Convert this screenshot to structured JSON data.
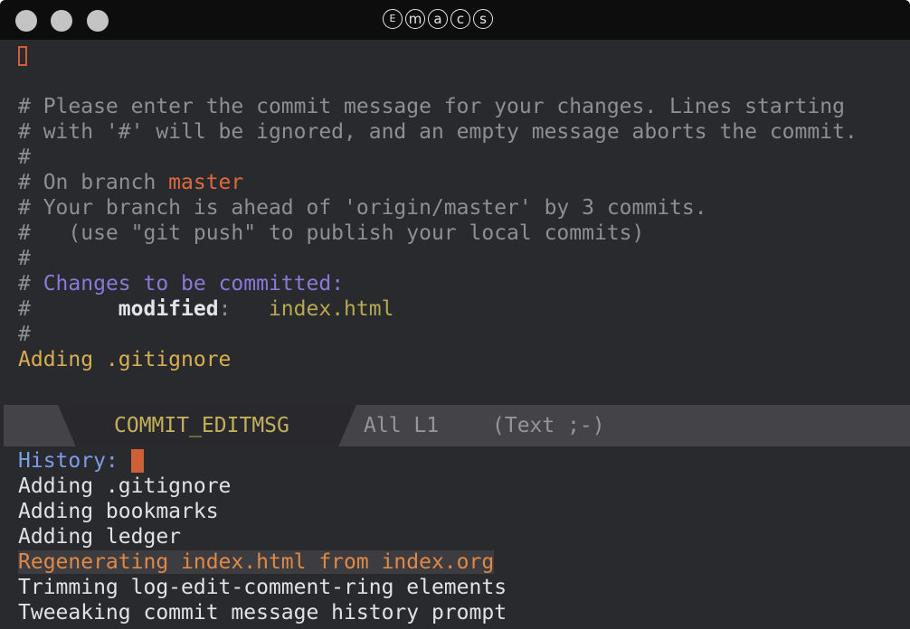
{
  "window": {
    "title_letters": [
      "E",
      "m",
      "a",
      "c",
      "s"
    ]
  },
  "editor": {
    "lines": [
      "# Please enter the commit message for your changes. Lines starting",
      "# with '#' will be ignored, and an empty message aborts the commit.",
      "#"
    ],
    "branch_prefix": "# On branch ",
    "branch": "master",
    "ahead_line": "# Your branch is ahead of 'origin/master' by 3 commits.",
    "push_hint": "#   (use \"git push\" to publish your local commits)",
    "blank_comment": "#",
    "changes_hash": "# ",
    "changes_header": "Changes to be committed:",
    "modified_prefix": "#       ",
    "modified_label": "modified",
    "modified_sep": ":   ",
    "modified_file": "index.html",
    "end_comment": "#",
    "message": "Adding .gitignore"
  },
  "modeline": {
    "buffer_name": "COMMIT_EDITMSG",
    "position": "All L1",
    "mode": "(Text ;-)"
  },
  "minibuffer": {
    "prompt": "History:",
    "history": [
      "Adding .gitignore",
      "Adding bookmarks",
      "Adding ledger",
      "Regenerating index.html from index.org",
      "Trimming log-edit-comment-ring elements",
      "Tweeaking commit message history prompt"
    ],
    "selected_index": 3
  },
  "colors": {
    "background": "#292a2e",
    "comment": "#8e8e95",
    "branch": "#e0683f",
    "section": "#8b78db",
    "file": "#b7a94f",
    "message": "#d8ae53",
    "cursor": "#d15f35",
    "prompt": "#7c9de8"
  }
}
